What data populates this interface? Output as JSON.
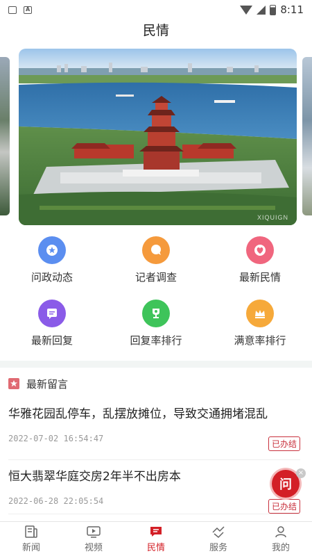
{
  "status_bar": {
    "time": "8:11"
  },
  "header": {
    "title": "民情"
  },
  "carousel": {
    "watermark": "XIQUIGN"
  },
  "features": [
    {
      "label": "问政动态",
      "icon": "star-badge-icon",
      "color": "#5b8ef0"
    },
    {
      "label": "记者调查",
      "icon": "chat-bubble-icon",
      "color": "#f59a3c"
    },
    {
      "label": "最新民情",
      "icon": "heart-icon",
      "color": "#f0667e"
    },
    {
      "label": "最新回复",
      "icon": "message-icon",
      "color": "#8a5be8"
    },
    {
      "label": "回复率排行",
      "icon": "trophy-icon",
      "color": "#3ec45a"
    },
    {
      "label": "满意率排行",
      "icon": "crown-icon",
      "color": "#f6a93a"
    }
  ],
  "latest": {
    "section_title": "最新留言",
    "items": [
      {
        "title": "华雅花园乱停车，乱摆放摊位，导致交通拥堵混乱",
        "time": "2022-07-02 16:54:47",
        "status": "已办结"
      },
      {
        "title": "恒大翡翠华庭交房2年半不出房本",
        "time": "2022-06-28 22:05:54",
        "status": "已办结"
      }
    ]
  },
  "fab": {
    "label": "问",
    "close": "×"
  },
  "nav": [
    {
      "label": "新闻",
      "icon": "news-icon"
    },
    {
      "label": "视频",
      "icon": "video-icon"
    },
    {
      "label": "民情",
      "icon": "opinion-icon"
    },
    {
      "label": "服务",
      "icon": "service-icon"
    },
    {
      "label": "我的",
      "icon": "profile-icon"
    }
  ],
  "colors": {
    "accent": "#d31f26",
    "status_tag": "#c8303c"
  }
}
